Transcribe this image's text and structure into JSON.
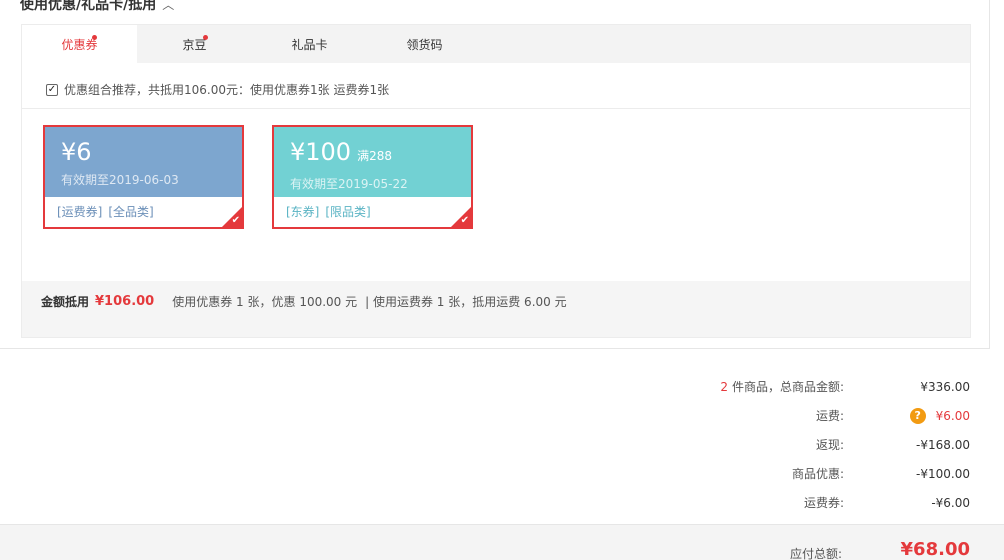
{
  "section": {
    "title": "使用优惠/礼品卡/抵用",
    "chevron": "^"
  },
  "tabs": [
    {
      "label": "优惠券",
      "active": true,
      "dot": true
    },
    {
      "label": "京豆",
      "active": false,
      "dot": true
    },
    {
      "label": "礼品卡",
      "active": false,
      "dot": false
    },
    {
      "label": "领货码",
      "active": false,
      "dot": false
    }
  ],
  "combo": {
    "checked": true,
    "text": "优惠组合推荐，共抵用106.00元：使用优惠券1张 运费券1张"
  },
  "coupons": [
    {
      "amount": "¥6",
      "condition": "",
      "expiry": "有效期至2019-06-03",
      "tag1": "[运费券]",
      "tag2": "[全品类]",
      "selected": true,
      "color": "#7da6cf"
    },
    {
      "amount": "¥100",
      "condition": "满288",
      "expiry": "有效期至2019-05-22",
      "tag1": "[东券]",
      "tag2": "[限品类]",
      "selected": true,
      "color": "#72d1d3"
    }
  ],
  "summary": {
    "label": "金额抵用",
    "amount": "¥106.00",
    "detail1": "使用优惠券 1 张，优惠 100.00 元",
    "detail2": "| 使用运费券 1 张，抵用运费 6.00 元"
  },
  "fees": {
    "goods_count": "2",
    "goods_label": "件商品，总商品金额:",
    "goods_value": "¥336.00",
    "shipping_label": "运费:",
    "shipping_value": "¥6.00",
    "cashback_label": "返现:",
    "cashback_value": "-¥168.00",
    "discount_label": "商品优惠:",
    "discount_value": "-¥100.00",
    "shipcoupon_label": "运费券:",
    "shipcoupon_value": "-¥6.00"
  },
  "total": {
    "label": "应付总额:",
    "value": "¥68.00"
  },
  "colors": {
    "accent": "#e4393c",
    "blue_coupon": "#7da6cf",
    "teal_coupon": "#72d1d3",
    "help_icon": "#f29b12"
  },
  "icons": {
    "check": "checkmark-icon",
    "help": "question-icon",
    "chevron": "chevron-up-icon"
  }
}
